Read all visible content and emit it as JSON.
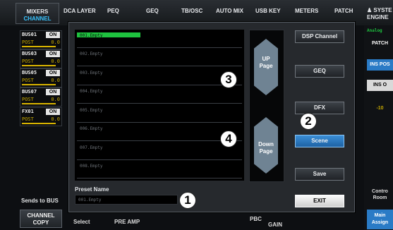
{
  "tabs": [
    {
      "label": "MIXERS",
      "sub": "CHANNEL"
    },
    {
      "label": "DCA LAYER"
    },
    {
      "label": "PEQ"
    },
    {
      "label": "GEQ"
    },
    {
      "label": "TB/OSC"
    },
    {
      "label": "AUTO MIX"
    },
    {
      "label": "USB KEY"
    },
    {
      "label": "METERS"
    },
    {
      "label": "PATCH"
    }
  ],
  "system_tab": {
    "line1": "♟ SYSTE",
    "line2": "ENGINE"
  },
  "buses": [
    {
      "name": "BUS01",
      "on": "ON",
      "post": "POST",
      "value": "0.0"
    },
    {
      "name": "BUS03",
      "on": "ON",
      "post": "POST",
      "value": "0.0"
    },
    {
      "name": "BUS05",
      "on": "ON",
      "post": "POST",
      "value": "0.0"
    },
    {
      "name": "BUS07",
      "on": "ON",
      "post": "POST",
      "value": "0.0"
    },
    {
      "name": "FX01",
      "on": "ON",
      "post": "POST",
      "value": "0.0"
    }
  ],
  "sends_label": "Sends to BUS",
  "channel_copy": {
    "line1": "CHANNEL",
    "line2": "COPY"
  },
  "bottom_bar": {
    "select": "Select",
    "preamp": "PRE AMP",
    "pbc": "PBC",
    "gain": "GAIN"
  },
  "right_strip": {
    "analog": "Analog",
    "patch": "PATCH",
    "ins_pos": "INS POS",
    "ins_o": "INS O",
    "meter_top": "-10",
    "control": "Contro",
    "room": "Room",
    "main": "Main",
    "assign": "Assign"
  },
  "dialog": {
    "presets": [
      "001.Empty",
      "002.Empty",
      "003.Empty",
      "004.Empty",
      "005.Empty",
      "006.Empty",
      "007.Empty",
      "008.Empty"
    ],
    "selected_index": 0,
    "page_up": {
      "line1": "UP",
      "line2": "Page"
    },
    "page_down": {
      "line1": "Down",
      "line2": "Page"
    },
    "buttons": {
      "dsp_channel": "DSP Channel",
      "geq": "GEQ",
      "dfx": "DFX",
      "scene": "Scene",
      "save": "Save",
      "exit": "EXIT"
    },
    "preset_name_label": "Preset Name",
    "preset_name_value": "001.Empty"
  },
  "callouts": {
    "c1": "1",
    "c2": "2",
    "c3": "3",
    "c4": "4"
  },
  "colors": {
    "selection": "#1ec23f",
    "active_button": "#2a7bc6",
    "accent_text": "#39c4ff",
    "bus_text": "#c6a800"
  }
}
